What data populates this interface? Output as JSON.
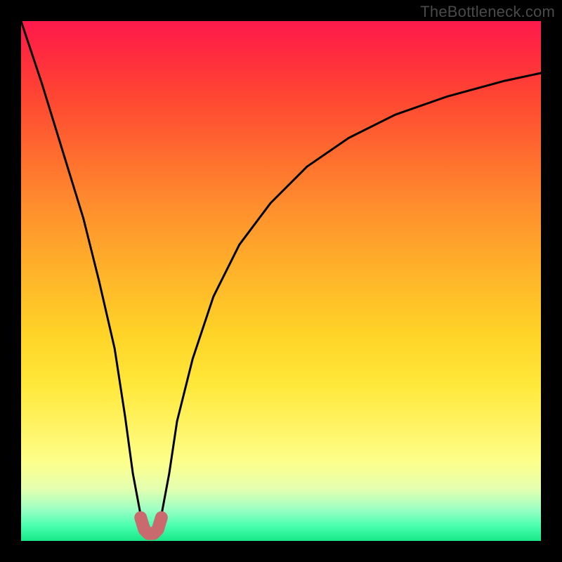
{
  "watermark": "TheBottleneck.com",
  "chart_data": {
    "type": "line",
    "title": "",
    "xlabel": "",
    "ylabel": "",
    "xlim": [
      0,
      100
    ],
    "ylim": [
      0,
      100
    ],
    "background_gradient_meaning": "vertical gradient, red=high (top) to green=low (bottom), representing bottleneck severity",
    "series": [
      {
        "name": "bottleneck-curve",
        "x": [
          0,
          4,
          8,
          12,
          15,
          18,
          20,
          21.5,
          23,
          24,
          25,
          26,
          27,
          28.5,
          30,
          33,
          37,
          42,
          48,
          55,
          63,
          72,
          82,
          93,
          100
        ],
        "values": [
          100,
          88,
          75,
          62,
          50,
          37,
          24,
          13,
          5,
          1.5,
          1,
          1.5,
          5,
          13,
          23,
          35,
          47,
          57,
          65,
          72,
          77.5,
          82,
          85.5,
          88.5,
          90
        ]
      },
      {
        "name": "highlight-segment",
        "x": [
          23,
          23.7,
          24.5,
          25.5,
          26.3,
          27
        ],
        "values": [
          4.5,
          2.2,
          1.4,
          1.4,
          2.2,
          4.5
        ]
      }
    ],
    "colors": {
      "curve": "#000000",
      "highlight": "#c96a6e"
    }
  }
}
